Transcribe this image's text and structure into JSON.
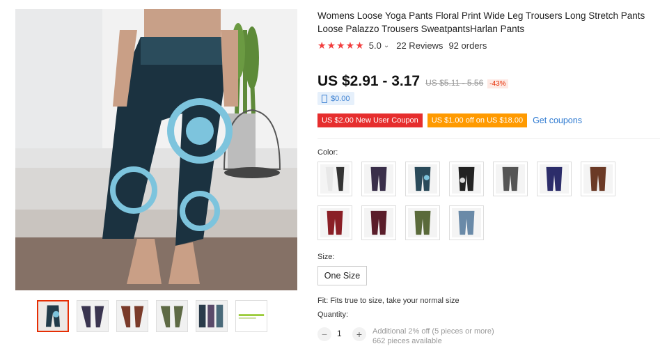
{
  "product": {
    "title": "Womens Loose Yoga Pants Floral Print Wide Leg Trousers Long Stretch Pants Loose Palazzo Trousers SweatpantsHarlan Pants",
    "stars": "★★★★★",
    "rating": "5.0",
    "reviews": "22 Reviews",
    "orders": "92 orders"
  },
  "price": {
    "current": "US $2.91 - 3.17",
    "original": "US $5.11 - 5.56",
    "discount": "-43%",
    "app_price": "$0.00"
  },
  "coupons": {
    "new_user": "US $2.00 New User Coupon",
    "store": "US $1.00 off on US $18.00",
    "get_link": "Get coupons"
  },
  "options": {
    "color_label": "Color:",
    "colors": [
      "white-black",
      "purple-floral",
      "blue-mandala",
      "black-white",
      "grey-pattern",
      "navy-purple",
      "brown-floral",
      "red-wine",
      "maroon",
      "olive-green",
      "light-blue"
    ],
    "size_label": "Size:",
    "size_value": "One Size"
  },
  "fit_note": "Fit: Fits true to size, take your normal size",
  "quantity": {
    "label": "Quantity:",
    "value": "1",
    "minus": "−",
    "plus": "+",
    "promo": "Additional 2% off (5 pieces or more)",
    "available": "662 pieces available"
  },
  "colors": {
    "accent_red": "#e62e04",
    "coupon_red": "#e62e2e",
    "coupon_orange": "#ff9a00",
    "link_blue": "#2e7ad1",
    "star": "#f23d3d"
  }
}
